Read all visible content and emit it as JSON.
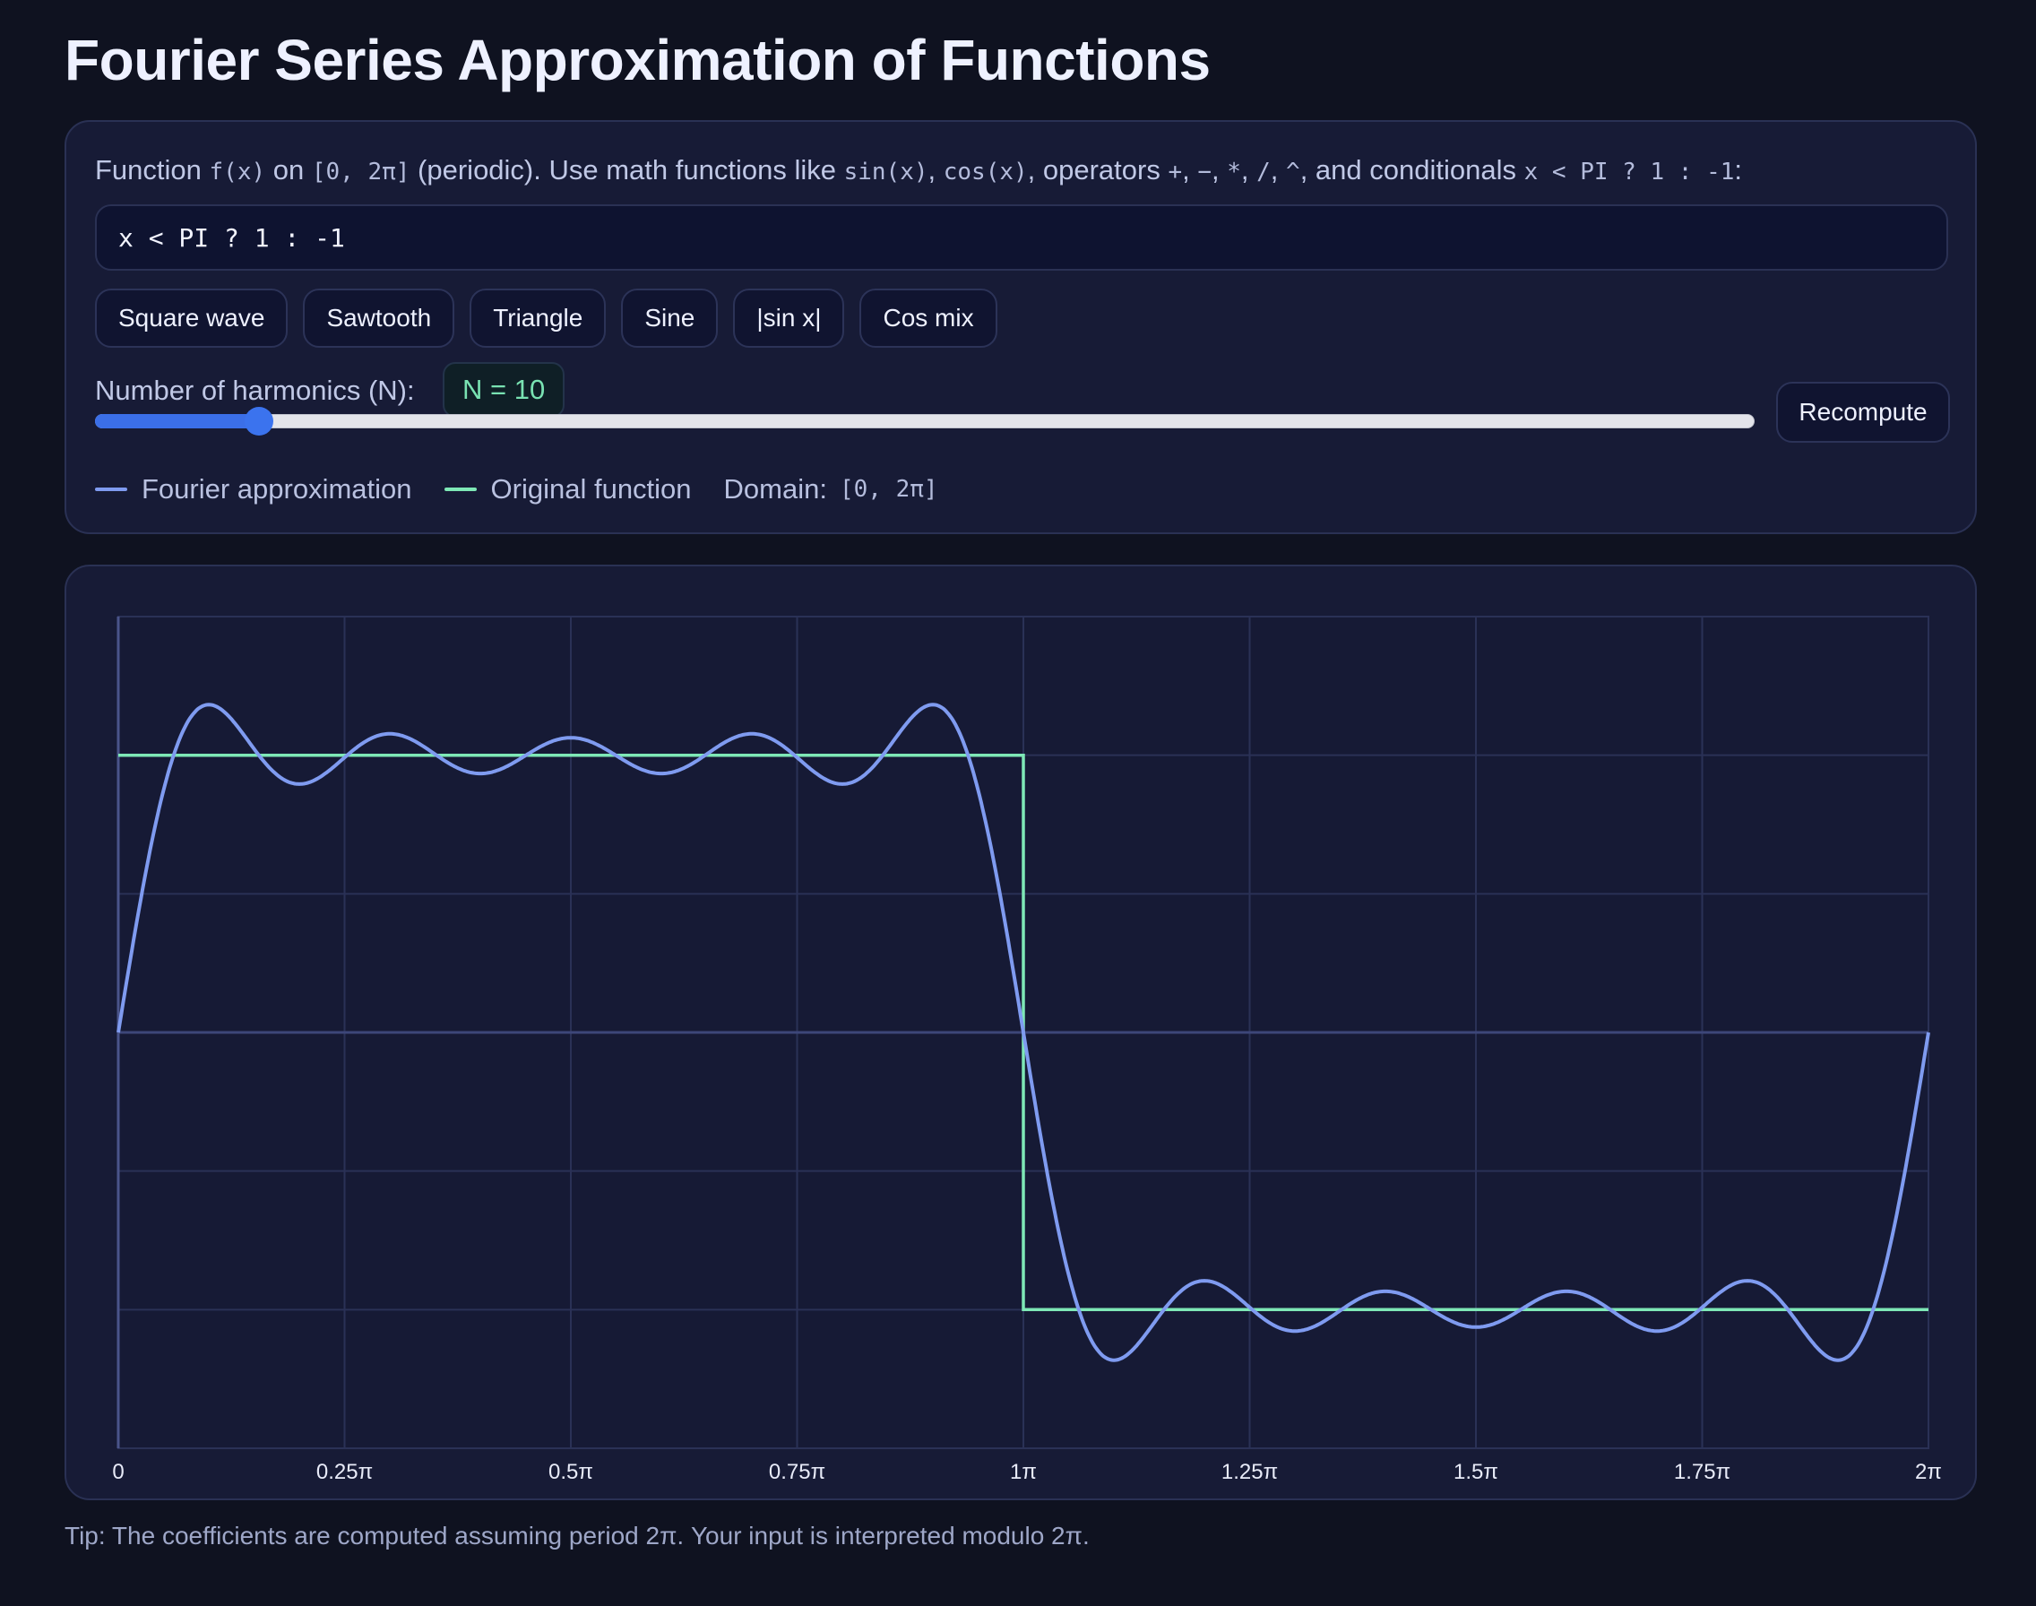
{
  "title": "Fourier Series Approximation of Functions",
  "description": {
    "t1": "Function ",
    "c1": "f(x)",
    "t2": " on ",
    "c2": "[0, 2π]",
    "t3": " (periodic). Use math functions like ",
    "c3": "sin(x)",
    "t4": ", ",
    "c4": "cos(x)",
    "t5": ", operators ",
    "c5": "+",
    "t6": ", ",
    "c6": "−",
    "t7": ", ",
    "c7": "*",
    "t8": ", ",
    "c8": "/",
    "t9": ", ",
    "c9": "^",
    "t10": ", and conditionals ",
    "c10": "x < PI ? 1 : -1",
    "t11": ":"
  },
  "function_input": {
    "value": "x < PI ? 1 : -1"
  },
  "presets": [
    "Square wave",
    "Sawtooth",
    "Triangle",
    "Sine",
    "|sin x|",
    "Cos mix"
  ],
  "harmonics": {
    "label": "Number of harmonics (N):",
    "badge": "N = 10",
    "value": 10,
    "slider_fraction": 0.0986
  },
  "recompute_label": "Recompute",
  "legend": {
    "approx": "Fourier approximation",
    "original": "Original function",
    "domain_label": "Domain:",
    "domain_value": "[0, 2π]"
  },
  "colors": {
    "approx": "#7f9bf0",
    "original": "#7ee8b6",
    "accent": "#3b6fe8"
  },
  "chart_data": {
    "type": "line",
    "x_tick_labels": [
      "0",
      "0.25π",
      "0.5π",
      "0.75π",
      "1π",
      "1.25π",
      "1.5π",
      "1.75π",
      "2π"
    ],
    "xlim": [
      0,
      6.283185307
    ],
    "ylim": [
      -1.5,
      1.5
    ],
    "grid": true,
    "harmonics": 10,
    "series": [
      {
        "name": "Original function",
        "color": "#7ee8b6",
        "x": [
          0,
          3.14159,
          3.14159,
          6.28319
        ],
        "y": [
          1,
          1,
          -1,
          -1
        ]
      },
      {
        "name": "Fourier approximation",
        "color": "#7f9bf0",
        "x": [
          0,
          0.157,
          0.314,
          0.471,
          0.628,
          0.785,
          0.942,
          1.1,
          1.257,
          1.414,
          1.571,
          1.728,
          1.885,
          2.042,
          2.199,
          2.356,
          2.513,
          2.67,
          2.827,
          2.985,
          3.142,
          3.299,
          3.456,
          3.613,
          3.77,
          3.927,
          4.084,
          4.241,
          4.398,
          4.555,
          4.712,
          4.869,
          5.027,
          5.184,
          5.341,
          5.498,
          5.655,
          5.812,
          5.969,
          6.126,
          6.283
        ],
        "y": [
          0,
          1.09,
          1.18,
          1.04,
          0.94,
          0.99,
          1.07,
          1.02,
          0.97,
          0.99,
          1.04,
          0.99,
          0.97,
          1.02,
          1.07,
          0.99,
          0.94,
          1.04,
          1.18,
          1.09,
          0,
          -1.09,
          -1.18,
          -1.04,
          -0.94,
          -0.99,
          -1.07,
          -1.02,
          -0.97,
          -0.99,
          -1.04,
          -0.99,
          -0.97,
          -1.02,
          -1.07,
          -0.99,
          -0.94,
          -1.04,
          -1.18,
          -1.09,
          0
        ]
      }
    ]
  },
  "tip": "Tip: The coefficients are computed assuming period 2π. Your input is interpreted modulo 2π."
}
